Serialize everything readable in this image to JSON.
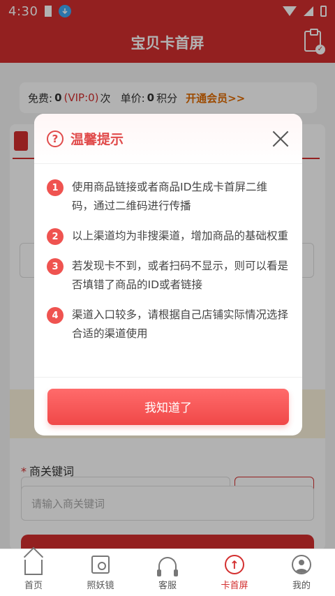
{
  "statusbar": {
    "time": "4:30"
  },
  "header": {
    "title": "宝贝卡首屏"
  },
  "infobar": {
    "free_label": "免费:",
    "free_count": "0",
    "vip_text": "(VIP:0)",
    "times_unit": "次",
    "price_label": "单价:",
    "price_value": "0",
    "price_unit": "积分",
    "open_member": "开通会员>>"
  },
  "form": {
    "keyword_label": "商关键词",
    "keyword_placeholder": "请输入商关键词"
  },
  "modal": {
    "title": "温馨提示",
    "tips": [
      {
        "num": "1",
        "text": "使用商品链接或者商品ID生成卡首屏二维码，通过二维码进行传播"
      },
      {
        "num": "2",
        "text": "以上渠道均为非搜渠道，增加商品的基础权重"
      },
      {
        "num": "3",
        "text": "若发现卡不到，或者扫码不显示，则可以看是否填错了商品的ID或者链接"
      },
      {
        "num": "4",
        "text": "渠道入口较多，请根据自己店铺实际情况选择合适的渠道使用"
      }
    ],
    "confirm_label": "我知道了"
  },
  "tabbar": {
    "items": [
      {
        "label": "首页",
        "icon": "home-icon"
      },
      {
        "label": "照妖镜",
        "icon": "mirror-icon"
      },
      {
        "label": "客服",
        "icon": "headset-icon"
      },
      {
        "label": "卡首屏",
        "icon": "card-screen-icon"
      },
      {
        "label": "我的",
        "icon": "profile-icon"
      }
    ],
    "active": "卡首屏"
  },
  "colors": {
    "brand": "#d32f2f",
    "modal_accent": "#e04b4b",
    "button": "#f04848"
  }
}
